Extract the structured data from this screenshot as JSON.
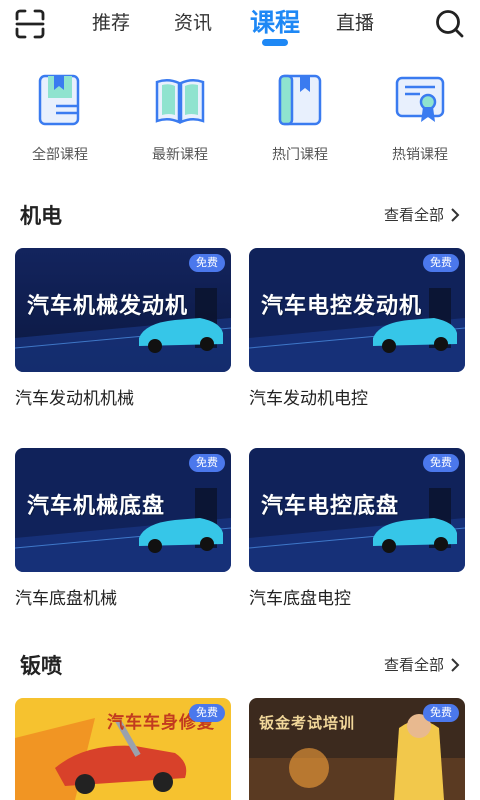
{
  "nav": {
    "tabs": [
      {
        "label": "推荐"
      },
      {
        "label": "资讯"
      },
      {
        "label": "课程"
      },
      {
        "label": "直播"
      }
    ],
    "active_tab": "课程"
  },
  "categories": [
    {
      "label": "全部课程",
      "icon": "book-list-icon"
    },
    {
      "label": "最新课程",
      "icon": "open-book-icon"
    },
    {
      "label": "热门课程",
      "icon": "bookmarked-book-icon"
    },
    {
      "label": "热销课程",
      "icon": "certificate-icon"
    }
  ],
  "sections": [
    {
      "title": "机电",
      "more": "查看全部",
      "courses": [
        {
          "banner": "汽车机械发动机",
          "title": "汽车发动机机械",
          "badge": "免费"
        },
        {
          "banner": "汽车电控发动机",
          "title": "汽车发动机电控",
          "badge": "免费"
        },
        {
          "banner": "汽车机械底盘",
          "title": "汽车底盘机械",
          "badge": "免费"
        },
        {
          "banner": "汽车电控底盘",
          "title": "汽车底盘电控",
          "badge": "免费"
        }
      ]
    },
    {
      "title": "钣喷",
      "more": "查看全部",
      "courses": [
        {
          "banner": "汽车车身修复",
          "title": "",
          "badge": "免费"
        },
        {
          "banner": "钣金考试培训",
          "title": "",
          "badge": "免费"
        }
      ]
    }
  ],
  "colors": {
    "accent": "#1e88f5",
    "badge": "#4b78ec"
  }
}
